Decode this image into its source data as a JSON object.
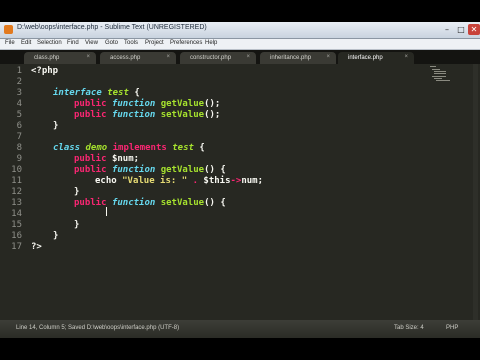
{
  "window": {
    "title": "D:\\web\\oops\\interface.php - Sublime Text (UNREGISTERED)",
    "controls": {
      "minimize": "–",
      "maximize": "□",
      "close": "✕"
    }
  },
  "menu": [
    "File",
    "Edit",
    "Selection",
    "Find",
    "View",
    "Goto",
    "Tools",
    "Project",
    "Preferences",
    "Help"
  ],
  "tabs": [
    {
      "label": "class.php",
      "close": "×",
      "active": false
    },
    {
      "label": "access.php",
      "close": "×",
      "active": false
    },
    {
      "label": "constructor.php",
      "close": "×",
      "active": false
    },
    {
      "label": "inheritance.php",
      "close": "×",
      "active": false
    },
    {
      "label": "interface.php",
      "close": "×",
      "active": true
    }
  ],
  "gutter": [
    "1",
    "2",
    "3",
    "4",
    "5",
    "6",
    "7",
    "8",
    "9",
    "10",
    "11",
    "12",
    "13",
    "14",
    "15",
    "16",
    "17"
  ],
  "code": {
    "l1_open": "<?php",
    "l3_interface": "interface",
    "l3_name": "test",
    "l3_brace": "{",
    "l4_public": "public",
    "l4_function": "function",
    "l4_name": "getValue",
    "l4_rest": "();",
    "l5_public": "public",
    "l5_function": "function",
    "l5_name": "setValue",
    "l5_rest": "();",
    "l6_close": "}",
    "l8_class": "class",
    "l8_name": "demo",
    "l8_implements": "implements",
    "l8_iface": "test",
    "l8_brace": "{",
    "l9_public": "public",
    "l9_rest": "$num;",
    "l10_public": "public",
    "l10_function": "function",
    "l10_name": "getValue",
    "l10_rest": "() {",
    "l11_echo": "echo",
    "l11_str": "\"Value is: \"",
    "l11_dot": ".",
    "l11_var": "$this",
    "l11_arrow": "->",
    "l11_rest": "num;",
    "l12_close": "}",
    "l13_public": "public",
    "l13_function": "function",
    "l13_name": "setValue",
    "l13_rest": "() {",
    "l15_close": "}",
    "l16_close": "}",
    "l17_end": "?>"
  },
  "status": {
    "left": "Line 14, Column 5; Saved D:\\web\\oops\\interface.php (UTF-8)",
    "tab_size": "Tab Size: 4",
    "syntax": "PHP"
  },
  "colors": {
    "background": "#272822",
    "keyword": "#f92672",
    "storage": "#66d9ef",
    "function": "#a6e22e",
    "string": "#e6db74"
  }
}
